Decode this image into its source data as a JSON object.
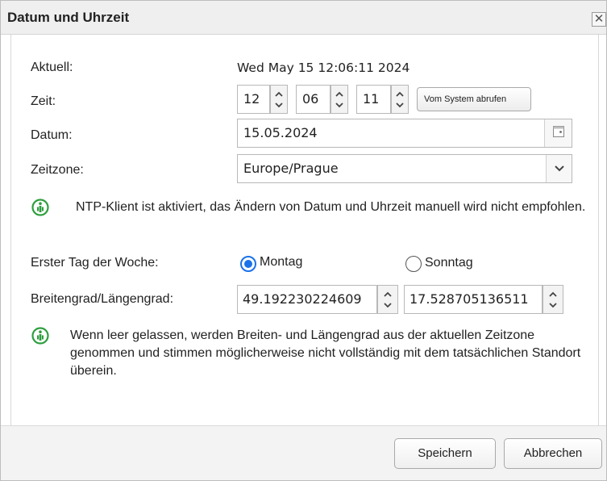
{
  "dialog": {
    "title": "Datum und Uhrzeit",
    "close_symbol": "✕"
  },
  "form": {
    "current_label": "Aktuell:",
    "current_value": "Wed May 15 12:06:11 2024",
    "time_label": "Zeit:",
    "time_hours": "12",
    "time_minutes": "06",
    "time_seconds": "11",
    "sync_button_label": "Vom System abrufen",
    "date_label": "Datum:",
    "date_value": "15.05.2024",
    "timezone_label": "Zeitzone:",
    "timezone_value": "Europe/Prague",
    "ntp_notice": "NTP-Klient ist aktiviert, das Ändern von Datum und Uhrzeit manuell wird nicht empfohlen.",
    "first_day_label": "Erster Tag der Woche:",
    "first_day_options": [
      {
        "label": "Montag",
        "checked": true
      },
      {
        "label": "Sonntag",
        "checked": false
      }
    ],
    "latlon_label": "Breitengrad/Längengrad:",
    "latitude_value": "49.192230224609",
    "longitude_value": "17.528705136511",
    "latlon_notice": "Wenn leer gelassen, werden Breiten- und Längengrad aus der aktuellen Zeitzone genommen und stimmen möglicherweise nicht vollständig mit dem tatsächlichen Standort überein."
  },
  "footer": {
    "save_label": "Speichern",
    "cancel_label": "Abbrechen"
  },
  "icons": {
    "info": "info-icon",
    "spin_up": "chevron-up-icon",
    "spin_down": "chevron-down-icon",
    "calendar": "calendar-icon",
    "dropdown": "chevron-down-icon",
    "close": "close-icon"
  },
  "colors": {
    "info_icon": "#2e9e3e",
    "radio_accent": "#1a73e8",
    "titlebar_bg": "#efefef",
    "footer_bg": "#f3f3f3"
  }
}
